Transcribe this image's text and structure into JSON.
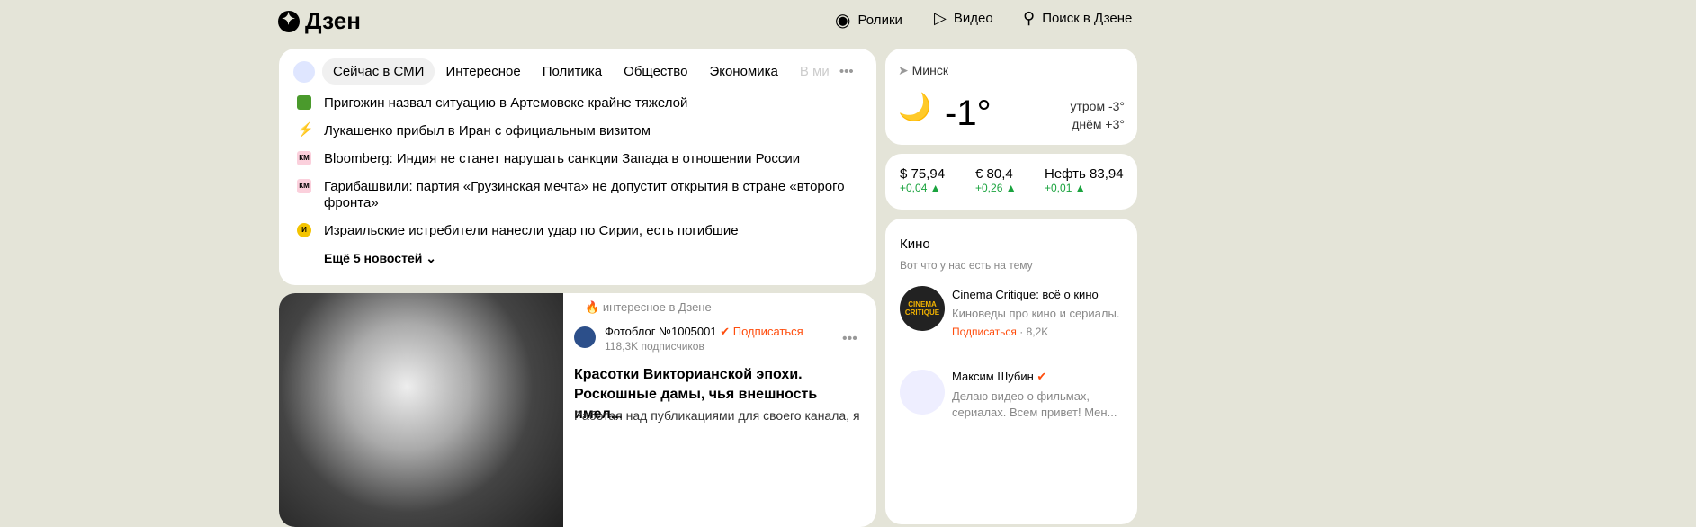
{
  "header": {
    "logo": "Дзен",
    "nav": [
      {
        "label": "Ролики",
        "icon": "shorts-icon"
      },
      {
        "label": "Видео",
        "icon": "play-icon"
      },
      {
        "label": "Поиск в Дзене",
        "icon": "search-icon"
      }
    ]
  },
  "news": {
    "tabs": [
      "Сейчас в СМИ",
      "Интересное",
      "Политика",
      "Общество",
      "Экономика",
      "В ми"
    ],
    "items": [
      {
        "text": "Пригожин назвал ситуацию в Артемовске крайне тяжелой",
        "source_icon": "green-square-icon"
      },
      {
        "text": "Лукашенко прибыл в Иран с официальным визитом",
        "source_icon": "lightning-icon"
      },
      {
        "text": "Bloomberg: Индия не станет нарушать санкции Запада в отношении России",
        "source_icon": "km-icon",
        "badge": "КМ"
      },
      {
        "text": "Гарибашвили: партия «Грузинская мечта» не допустит открытия в стране «второго фронта»",
        "source_icon": "km-icon",
        "badge": "КМ"
      },
      {
        "text": "Израильские истребители нанесли удар по Сирии, есть погибшие",
        "source_icon": "yellow-circle-icon",
        "badge": "И"
      }
    ],
    "more": "Ещё 5 новостей"
  },
  "weather": {
    "city": "Минск",
    "temp": "-1°",
    "morning": "утром -3°",
    "day": "днём +3°"
  },
  "rates": [
    {
      "label": "$ 75,94",
      "change": "+0,04"
    },
    {
      "label": "€ 80,4",
      "change": "+0,26"
    },
    {
      "label": "Нефть 83,94",
      "change": "+0,01"
    }
  ],
  "kino": {
    "title": "Кино",
    "subtitle": "Вот что у нас есть на тему",
    "channels": [
      {
        "name": "Cinema Critique: всё о кино",
        "desc": "Киноведы про кино и сериалы.",
        "subscribe": "Подписаться",
        "count": "· 8,2K",
        "logo": "CINEMA CRITIQUE"
      },
      {
        "name": "Максим Шубин",
        "desc": "Делаю видео о фильмах, сериалах. Всем привет! Мен..."
      }
    ]
  },
  "article": {
    "label": "интересное в Дзене",
    "channel": "Фотоблог №1005001",
    "subscribe": "Подписаться",
    "subscribers": "118,3K подписчиков",
    "title": "Красотки Викторианской эпохи. Роскошные дамы, чья внешность имел...",
    "snippet": "Работая над публикациями для своего канала, я"
  },
  "colors": {
    "background": "#e4e4d8",
    "accent": "#ff4d0d",
    "up": "#1aa33e"
  }
}
